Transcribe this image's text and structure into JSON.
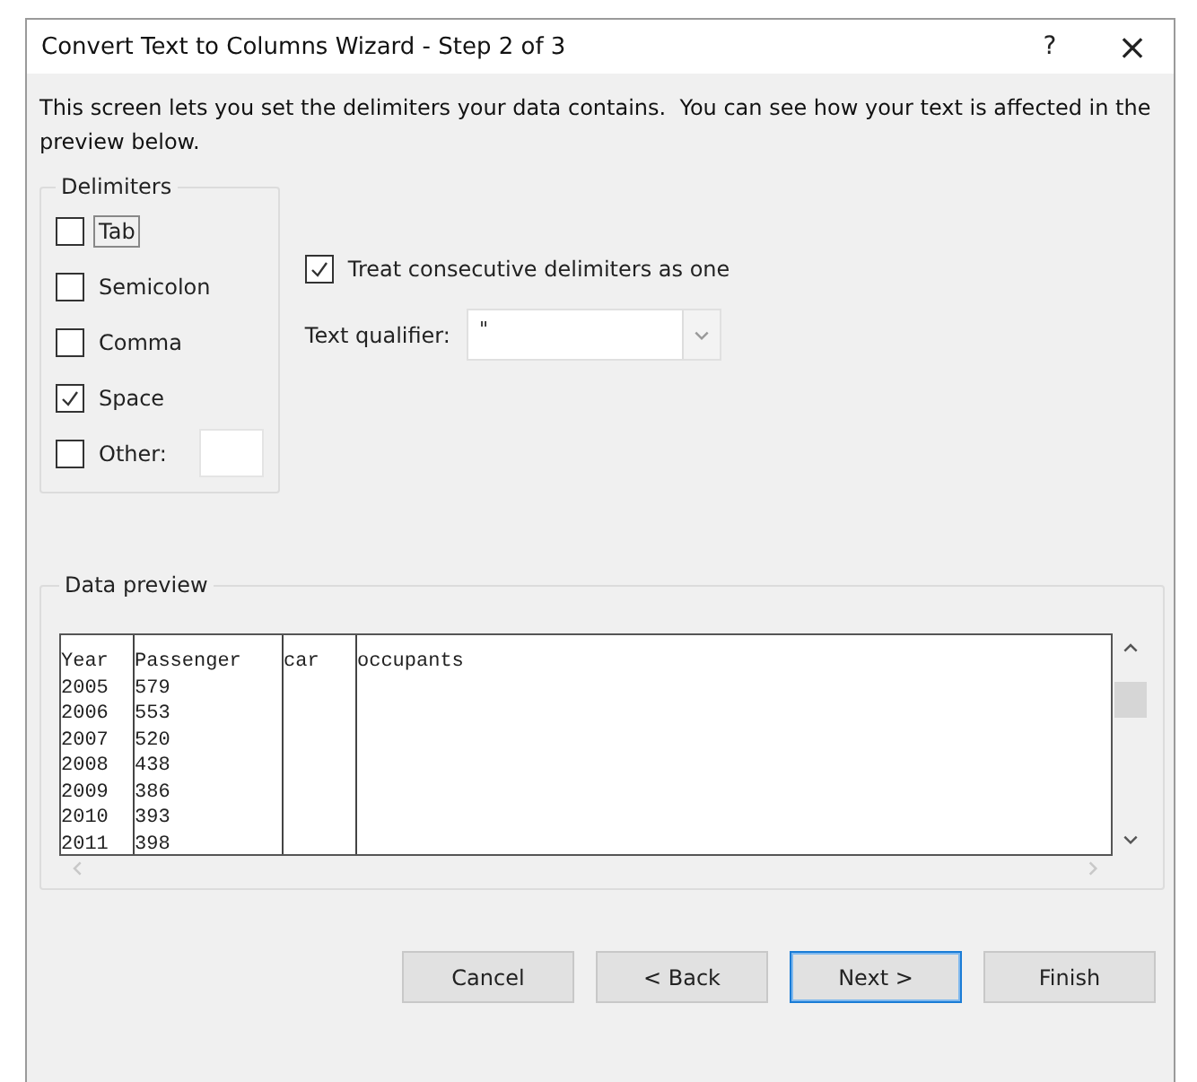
{
  "window": {
    "title": "Convert Text to Columns Wizard - Step 2 of 3",
    "help": "?",
    "close": "×"
  },
  "intro": "This screen lets you set the delimiters your data contains.  You can see how your text is affected in the preview below.",
  "delimiters": {
    "title": "Delimiters",
    "items": [
      {
        "label": "Tab",
        "checked": false,
        "focused": true
      },
      {
        "label": "Semicolon",
        "checked": false,
        "focused": false
      },
      {
        "label": "Comma",
        "checked": false,
        "focused": false
      },
      {
        "label": "Space",
        "checked": true,
        "focused": false
      },
      {
        "label": "Other:",
        "checked": false,
        "focused": false,
        "has_field": true
      }
    ]
  },
  "treat_consecutive": {
    "label": "Treat consecutive delimiters as one",
    "checked": true
  },
  "text_qualifier": {
    "label": "Text qualifier:",
    "value": "\""
  },
  "preview": {
    "title": "Data preview",
    "rows": [
      [
        "Year",
        "Passenger",
        "car",
        "occupants"
      ],
      [
        "2005",
        "579"
      ],
      [
        "2006",
        "553"
      ],
      [
        "2007",
        "520"
      ],
      [
        "2008",
        "438"
      ],
      [
        "2009",
        "386"
      ],
      [
        "2010",
        "393"
      ],
      [
        "2011",
        "398"
      ]
    ]
  },
  "buttons": [
    {
      "label": "Cancel",
      "default": false
    },
    {
      "label": "< Back",
      "default": false
    },
    {
      "label": "Next >",
      "default": true
    },
    {
      "label": "Finish",
      "default": false
    }
  ]
}
